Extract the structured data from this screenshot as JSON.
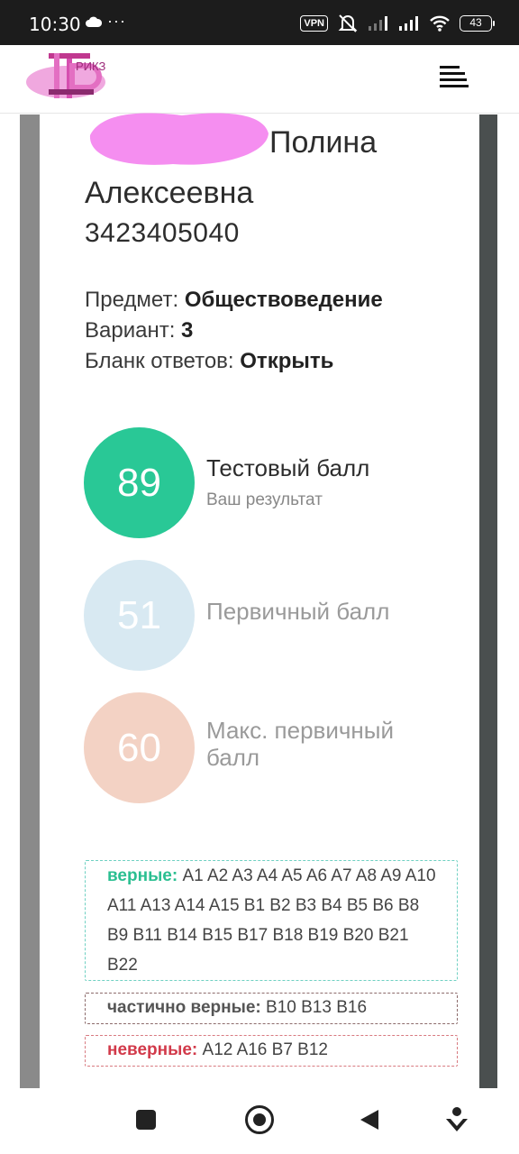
{
  "status_bar": {
    "time": "10:30",
    "dots": "···",
    "vpn": "VPN",
    "battery": "43"
  },
  "header": {
    "logo_text": "РИКЗ"
  },
  "student": {
    "name_visible": "Полина",
    "patronymic": "Алексеевна",
    "id": "3423405040"
  },
  "exam": {
    "subject_label": "Предмет: ",
    "subject": "Обществоведение",
    "variant_label": "Вариант: ",
    "variant": "3",
    "blank_label": "Бланк ответов: ",
    "blank_link": "Открыть"
  },
  "scores": {
    "test": {
      "value": "89",
      "title": "Тестовый балл",
      "subtitle": "Ваш результат",
      "color": "#29c896"
    },
    "primary": {
      "value": "51",
      "title": "Первичный балл",
      "color": "#d8e9f2"
    },
    "max_primary": {
      "value": "60",
      "title": "Макс. первичный балл",
      "color": "#f3d2c4"
    }
  },
  "answers": {
    "correct_label": "верные:",
    "correct": "A1 A2 A3 A4 A5 A6 A7 A8 A9 A10 A11 A13 A14 A15 B1 B2 B3 B4 B5 B6 B8 B9 B11 B14 B15 B17 B18 B19 B20 B21 B22",
    "partial_label": "частично верные:",
    "partial": "B10 B13 B16",
    "wrong_label": "неверные:",
    "wrong": "A12 A16 B7 B12"
  },
  "colors": {
    "correct": "#2bbf91",
    "wrong": "#d23a4a",
    "partial_border": "#8c6b6b"
  }
}
